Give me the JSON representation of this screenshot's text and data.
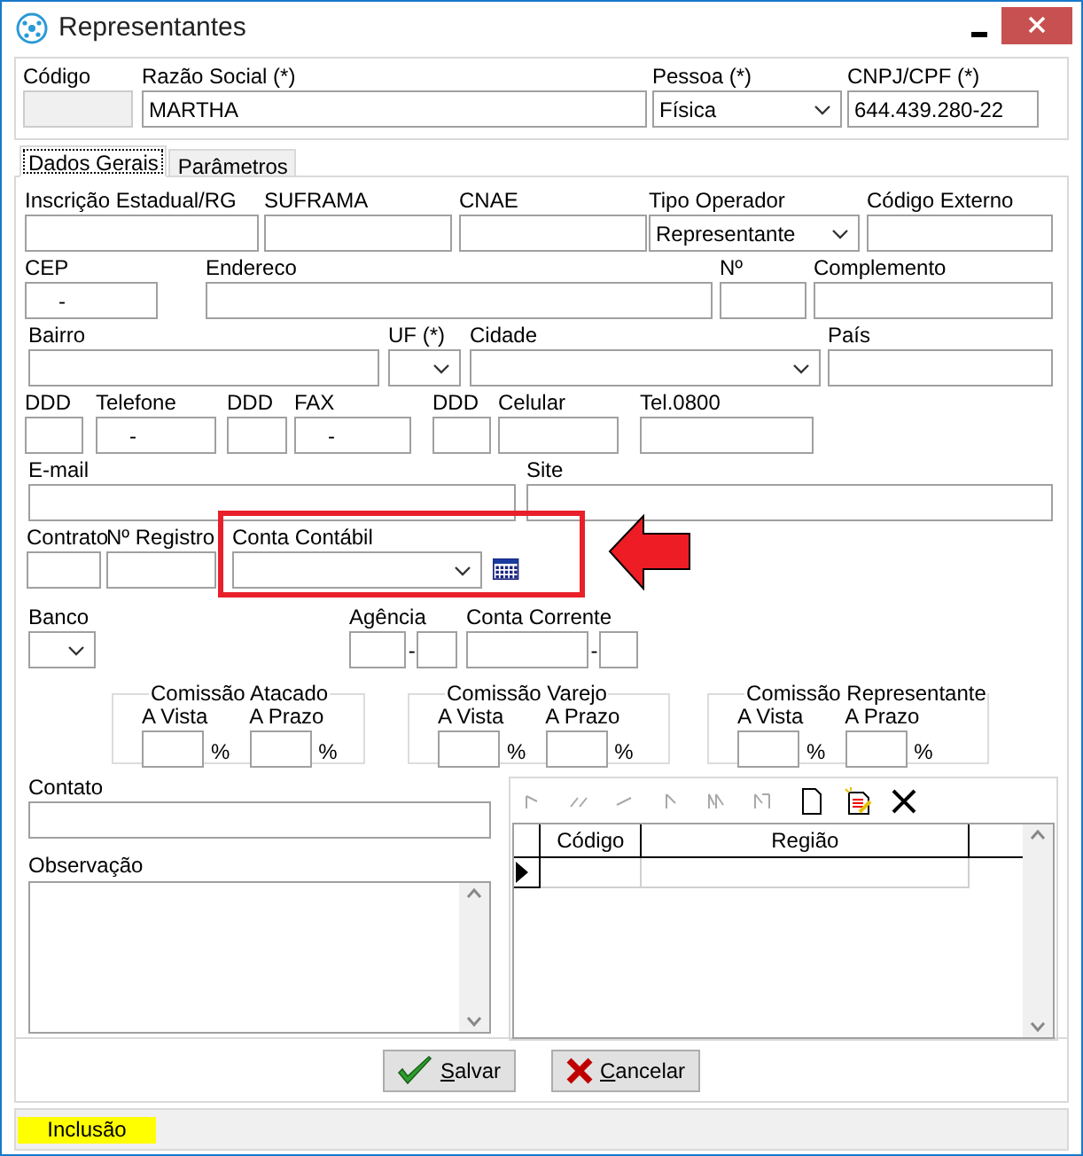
{
  "window": {
    "title": "Representantes"
  },
  "header": {
    "fields": [
      {
        "label": "Código",
        "kind": "text",
        "disabled": true
      },
      {
        "label": "Razão Social (*)",
        "kind": "text",
        "value": "MARTHA",
        "disabled": false
      },
      {
        "label": "Pessoa (*)",
        "kind": "select",
        "value": "Física",
        "disabled": false
      },
      {
        "label": "CNPJ/CPF (*)",
        "kind": "text",
        "value": "644.439.280-22",
        "disabled": false
      }
    ]
  },
  "tabs": [
    {
      "label": "Dados Gerais",
      "selected": true
    },
    {
      "label": "Parâmetros",
      "selected": false
    }
  ],
  "form_rows": [
    {
      "fields": [
        {
          "label": "Inscrição Estadual/RG",
          "kind": "text"
        },
        {
          "label": "SUFRAMA",
          "kind": "text"
        },
        {
          "label": "CNAE",
          "kind": "text"
        },
        {
          "label": "Tipo Operador",
          "kind": "select",
          "value": "Representante"
        },
        {
          "label": "Código Externo",
          "kind": "text"
        }
      ]
    },
    {
      "fields": [
        {
          "label": "CEP",
          "kind": "masked",
          "value": "-"
        },
        {
          "label": "Endereco",
          "kind": "text"
        },
        {
          "label": "Nº",
          "kind": "text"
        },
        {
          "label": "Complemento",
          "kind": "text"
        }
      ]
    },
    {
      "fields": [
        {
          "label": "Bairro",
          "kind": "text"
        },
        {
          "label": "UF (*)",
          "kind": "select"
        },
        {
          "label": "Cidade",
          "kind": "select"
        },
        {
          "label": "País",
          "kind": "text"
        }
      ]
    },
    {
      "fields": [
        {
          "label": "DDD",
          "kind": "text"
        },
        {
          "label": "Telefone",
          "kind": "masked",
          "value": "-"
        },
        {
          "label": "DDD",
          "kind": "text"
        },
        {
          "label": "FAX",
          "kind": "masked",
          "value": "-"
        },
        {
          "label": "DDD",
          "kind": "text"
        },
        {
          "label": "Celular",
          "kind": "text"
        },
        {
          "label": "Tel.0800",
          "kind": "text"
        }
      ]
    },
    {
      "fields": [
        {
          "label": "E-mail",
          "kind": "text"
        },
        {
          "label": "Site",
          "kind": "text"
        }
      ]
    },
    {
      "fields": [
        {
          "label": "Contrato",
          "kind": "text"
        },
        {
          "label": "Nº Registro",
          "kind": "text"
        },
        {
          "label": "Conta Contábil",
          "kind": "lookup",
          "highlighted": true
        }
      ]
    },
    {
      "fields": [
        {
          "label": "Banco",
          "kind": "select"
        },
        {
          "label": "Agência",
          "kind": "split",
          "separator": "-"
        },
        {
          "label": "Conta Corrente",
          "kind": "split",
          "separator": "-"
        }
      ]
    }
  ],
  "commissions": [
    {
      "title": "Comissão Atacado",
      "fields": [
        {
          "label": "A Vista",
          "unit": "%"
        },
        {
          "label": "A Prazo",
          "unit": "%"
        }
      ]
    },
    {
      "title": "Comissão Varejo",
      "fields": [
        {
          "label": "A Vista",
          "unit": "%"
        },
        {
          "label": "A Prazo",
          "unit": "%"
        }
      ]
    },
    {
      "title": "Comissão Representante",
      "fields": [
        {
          "label": "A Vista",
          "unit": "%"
        },
        {
          "label": "A Prazo",
          "unit": "%"
        }
      ]
    }
  ],
  "contato": {
    "label": "Contato"
  },
  "observacao": {
    "label": "Observação"
  },
  "grid": {
    "toolbar": [
      {
        "kind": "first",
        "disabled": true
      },
      {
        "kind": "prior_page",
        "disabled": true
      },
      {
        "kind": "prior",
        "disabled": true
      },
      {
        "kind": "next",
        "disabled": true
      },
      {
        "kind": "next_page",
        "disabled": true
      },
      {
        "kind": "last",
        "disabled": true
      },
      {
        "kind": "new",
        "disabled": false
      },
      {
        "kind": "edit",
        "disabled": false
      },
      {
        "kind": "delete",
        "disabled": false
      }
    ],
    "columns": [
      "Código",
      "Região"
    ]
  },
  "buttons": [
    {
      "kind": "save",
      "label": "Salvar"
    },
    {
      "kind": "cancel",
      "label": "Cancelar"
    }
  ],
  "status_bar": {
    "mode": "Inclusão"
  }
}
